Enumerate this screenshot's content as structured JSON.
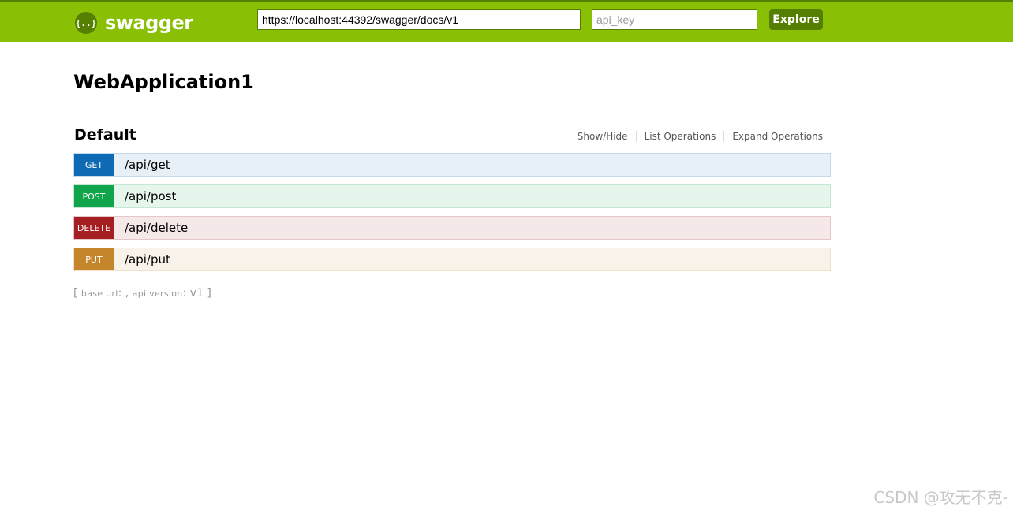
{
  "header": {
    "logo_icon": "{..}",
    "logo_text": "swagger",
    "url_value": "https://localhost:44392/swagger/docs/v1",
    "api_key_placeholder": "api_key",
    "explore_label": "Explore",
    "bg_color": "#89bf04"
  },
  "main": {
    "app_title": "WebApplication1",
    "section": {
      "title": "Default",
      "actions": [
        "Show/Hide",
        "List Operations",
        "Expand Operations"
      ]
    },
    "operations": [
      {
        "method": "GET",
        "path": "/api/get",
        "color": "#0f6ab4",
        "bg": "#e7eff7",
        "border": "#c3d9ec"
      },
      {
        "method": "POST",
        "path": "/api/post",
        "color": "#10a54a",
        "bg": "#e7f6ec",
        "border": "#c3e8d1"
      },
      {
        "method": "DELETE",
        "path": "/api/delete",
        "color": "#a41e22",
        "bg": "#f5e8e8",
        "border": "#e8c6c7"
      },
      {
        "method": "PUT",
        "path": "/api/put",
        "color": "#c5862b",
        "bg": "#f9f2e9",
        "border": "#f0e0ca"
      }
    ],
    "footer": {
      "open": "[",
      "base_url_label": "base url",
      "base_url_sep": ": ,",
      "api_version_label": "api version",
      "api_version_sep": ":",
      "api_version": "v1",
      "close": "]"
    }
  },
  "watermark": "CSDN @攻无不克-"
}
